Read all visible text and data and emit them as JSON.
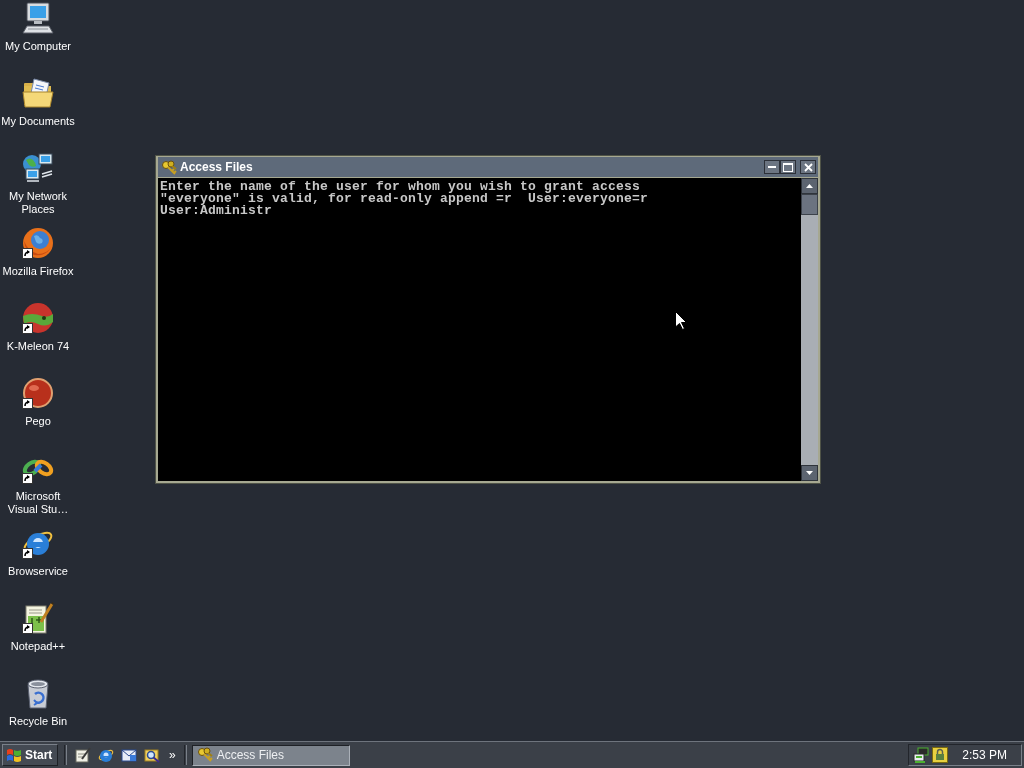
{
  "desktop_icons": [
    {
      "label": "My Computer",
      "kind": "computer",
      "shortcut": false
    },
    {
      "label": "My Documents",
      "kind": "documents",
      "shortcut": false
    },
    {
      "label": "My Network Places",
      "kind": "network",
      "shortcut": false
    },
    {
      "label": "Mozilla Firefox",
      "kind": "firefox",
      "shortcut": true
    },
    {
      "label": "K-Meleon 74",
      "kind": "kmeleon",
      "shortcut": true
    },
    {
      "label": "Pego",
      "kind": "pego",
      "shortcut": true
    },
    {
      "label": "Microsoft Visual Stu…",
      "kind": "visualstudio",
      "shortcut": true
    },
    {
      "label": "Browservice",
      "kind": "iexplore",
      "shortcut": true
    },
    {
      "label": "Notepad++",
      "kind": "notepadpp",
      "shortcut": true
    },
    {
      "label": "Recycle Bin",
      "kind": "recyclebin",
      "shortcut": false
    }
  ],
  "window": {
    "title": "Access Files",
    "console_lines": [
      "Enter the name of the user for whom you wish to grant access",
      "\"everyone\" is valid, for read-only append =r  User:everyone=r",
      "User:Administr"
    ]
  },
  "taskbar": {
    "start_label": "Start",
    "quick_launch_more": "»",
    "tasks": [
      {
        "label": "Access Files",
        "selected": true
      }
    ],
    "clock": "2:53 PM"
  }
}
